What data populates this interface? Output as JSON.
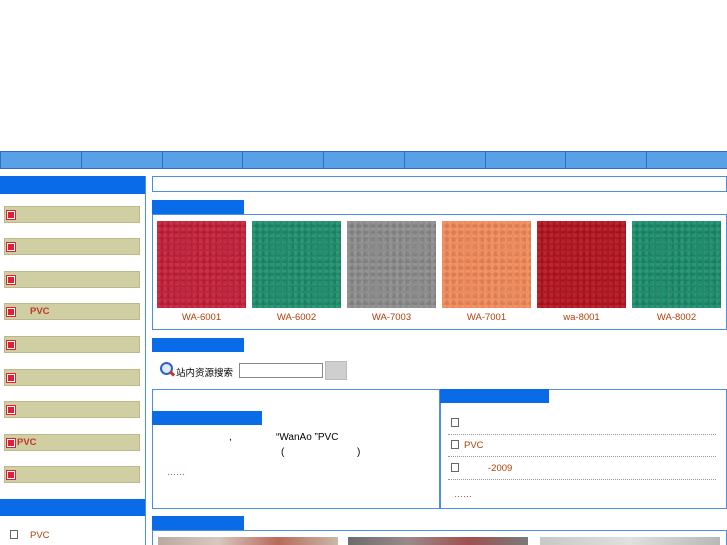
{
  "nav": {
    "items": [
      "",
      "",
      "",
      "",
      "",
      "",
      "",
      "",
      ""
    ]
  },
  "sidebar": {
    "categories": [
      "",
      "",
      "",
      "PVC",
      "",
      "",
      "",
      "PVC",
      ""
    ],
    "bottom_item": "PVC"
  },
  "products": {
    "items": [
      {
        "label": "WA-6001",
        "color": "#c3203a"
      },
      {
        "label": "WA-6002",
        "color": "#1e8d6b"
      },
      {
        "label": "WA-7003",
        "color": "#8c8c8c"
      },
      {
        "label": "WA-7001",
        "color": "#f08a5a"
      },
      {
        "label": "wa-8001",
        "color": "#b3141f"
      },
      {
        "label": "WA-8002",
        "color": "#1c8c6a"
      }
    ]
  },
  "search": {
    "label": "站内资源搜索",
    "value": "",
    "button": ""
  },
  "about": {
    "comma": ",",
    "brand": "“WanAo ”PVC",
    "paren_open": "(",
    "paren_close": ")",
    "more": "……"
  },
  "news": {
    "items": [
      "",
      "PVC",
      "-2009"
    ],
    "more": "……"
  },
  "colors": {
    "accent_blue": "#0a6be8",
    "nav_blue": "#5aa0e6",
    "category_bg": "#cfcfa3",
    "link_orange": "#b0400a"
  }
}
